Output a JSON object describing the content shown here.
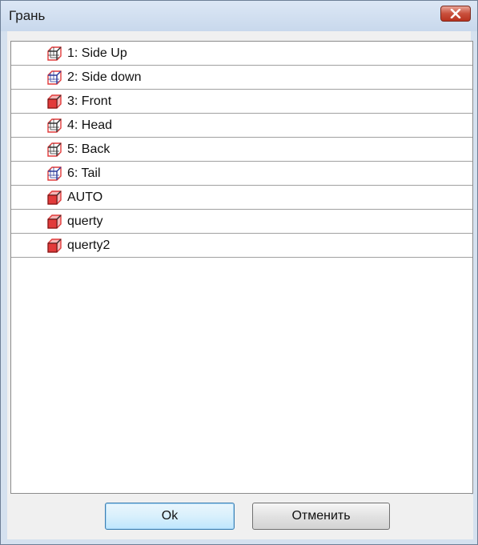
{
  "window": {
    "title": "Грань"
  },
  "list": {
    "items": [
      {
        "label": "1: Side Up",
        "icon": "cube-side-up-icon"
      },
      {
        "label": "2: Side down",
        "icon": "cube-side-down-icon"
      },
      {
        "label": "3: Front",
        "icon": "cube-front-icon"
      },
      {
        "label": "4: Head",
        "icon": "cube-head-icon"
      },
      {
        "label": "5: Back",
        "icon": "cube-back-icon"
      },
      {
        "label": "6: Tail",
        "icon": "cube-tail-icon"
      },
      {
        "label": "AUTO",
        "icon": "cube-auto-icon"
      },
      {
        "label": "querty",
        "icon": "cube-auto-icon"
      },
      {
        "label": "querty2",
        "icon": "cube-auto-icon"
      }
    ]
  },
  "buttons": {
    "ok_label": "Ok",
    "cancel_label": "Отменить"
  },
  "colors": {
    "accent": "#3c7fb1",
    "cube_red": "#e23a3a",
    "cube_blue": "#2b3a9a",
    "close_red": "#c9503c"
  }
}
